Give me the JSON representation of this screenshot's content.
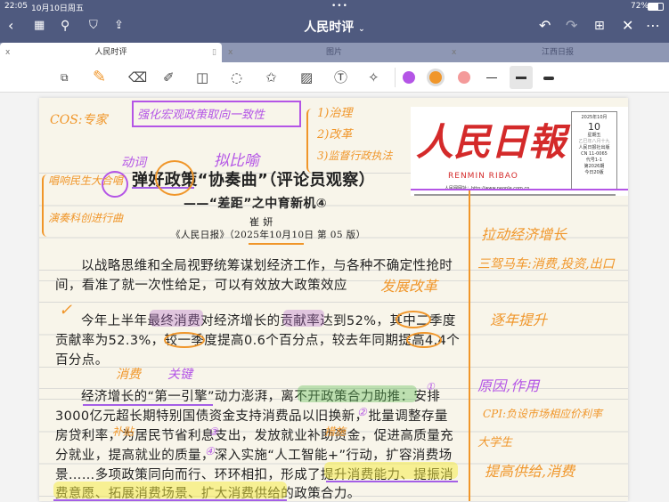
{
  "status": {
    "time": "22:05",
    "date": "10月10日周五",
    "battery": "72%"
  },
  "nav": {
    "title": "人民时评",
    "title_chevron": "⌄"
  },
  "tabs": [
    {
      "label": "人民时评",
      "close": "x"
    },
    {
      "label": "图片",
      "close": "x"
    },
    {
      "label": "江西日报",
      "close": "x"
    }
  ],
  "colors": {
    "accent_orange": "#f0962a",
    "purple": "#b455e6",
    "pink": "#f49a9a",
    "nav_bg": "#4f5a7f"
  },
  "article": {
    "title": "弹好政策“协奏曲”（评论员观察）",
    "subtitle": "——“差距”之中育新机④",
    "author": "崔 妍",
    "source": "《人民日报》（2025年10月10日 第 05 版）",
    "p1": [
      "以战略思维和全局视野统筹谋划经济工作，与各种不确定性抢时",
      "间，看准了就一次性给足，可以有效放大政策效应"
    ],
    "p2": [
      "今年上半年最终消费对经济增长的贡献率达到52%，其中二季度",
      "贡献率为52.3%，较一季度提高0.6个百分点，较去年同期提高4.4个",
      "百分点。"
    ],
    "p3": [
      "经济增长的“第一引擎”动力澎湃，离不开政策合力助推：安排",
      "3000亿元超长期特别国债资金支持消费品以旧换新，批量调整存量",
      "房贷利率，为居民节省利息支出，发放就业补助资金，促进高质量充",
      "分就业，提高就业的质量，深入实施“人工智能+”行动，扩容消费场",
      "景……多项政策同向而行、环环相扣，形成了提升消费能力、提振消",
      "费意愿、拓展消费场景、扩大消费供给的政策合力。"
    ]
  },
  "masthead": {
    "logo": "人民日報",
    "pinyin": "RENMIN RIBAO",
    "url": "人民网网址：http://www.people.com.cn",
    "date": "2025年10月",
    "day": "10",
    "weekday": "星期五",
    "lunar": "乙巳年八月十九",
    "paper": "人民日报社出版",
    "issn": "CN 11-0065",
    "code": "代号1-1",
    "issue": "第2026期",
    "pages": "今日20版"
  },
  "notes": {
    "n1": "COS:专家",
    "n2": "强化宏观政策取向一致性",
    "n3": "1)治理",
    "n4": "2)改革",
    "n5": "3)监督行政执法",
    "n6": "动词",
    "n7": "拟比喻",
    "n8": "唱响民生大合唱",
    "n9": "演奏科创进行曲",
    "n10": "发展改革",
    "n11": "拉动经济增长",
    "n12": "三驾马车:消费,投资,出口",
    "n13": "逐年提升",
    "n14": "消费",
    "n15": "关键",
    "n16": "原因,作用",
    "n17": "CPI:负设市场相应价利率",
    "n18": "大学生",
    "n19": "提高供给,消费",
    "n20": "补贴",
    "n21": "措施",
    "n22": "①",
    "n23": "②",
    "n24": "③",
    "n25": "④"
  }
}
